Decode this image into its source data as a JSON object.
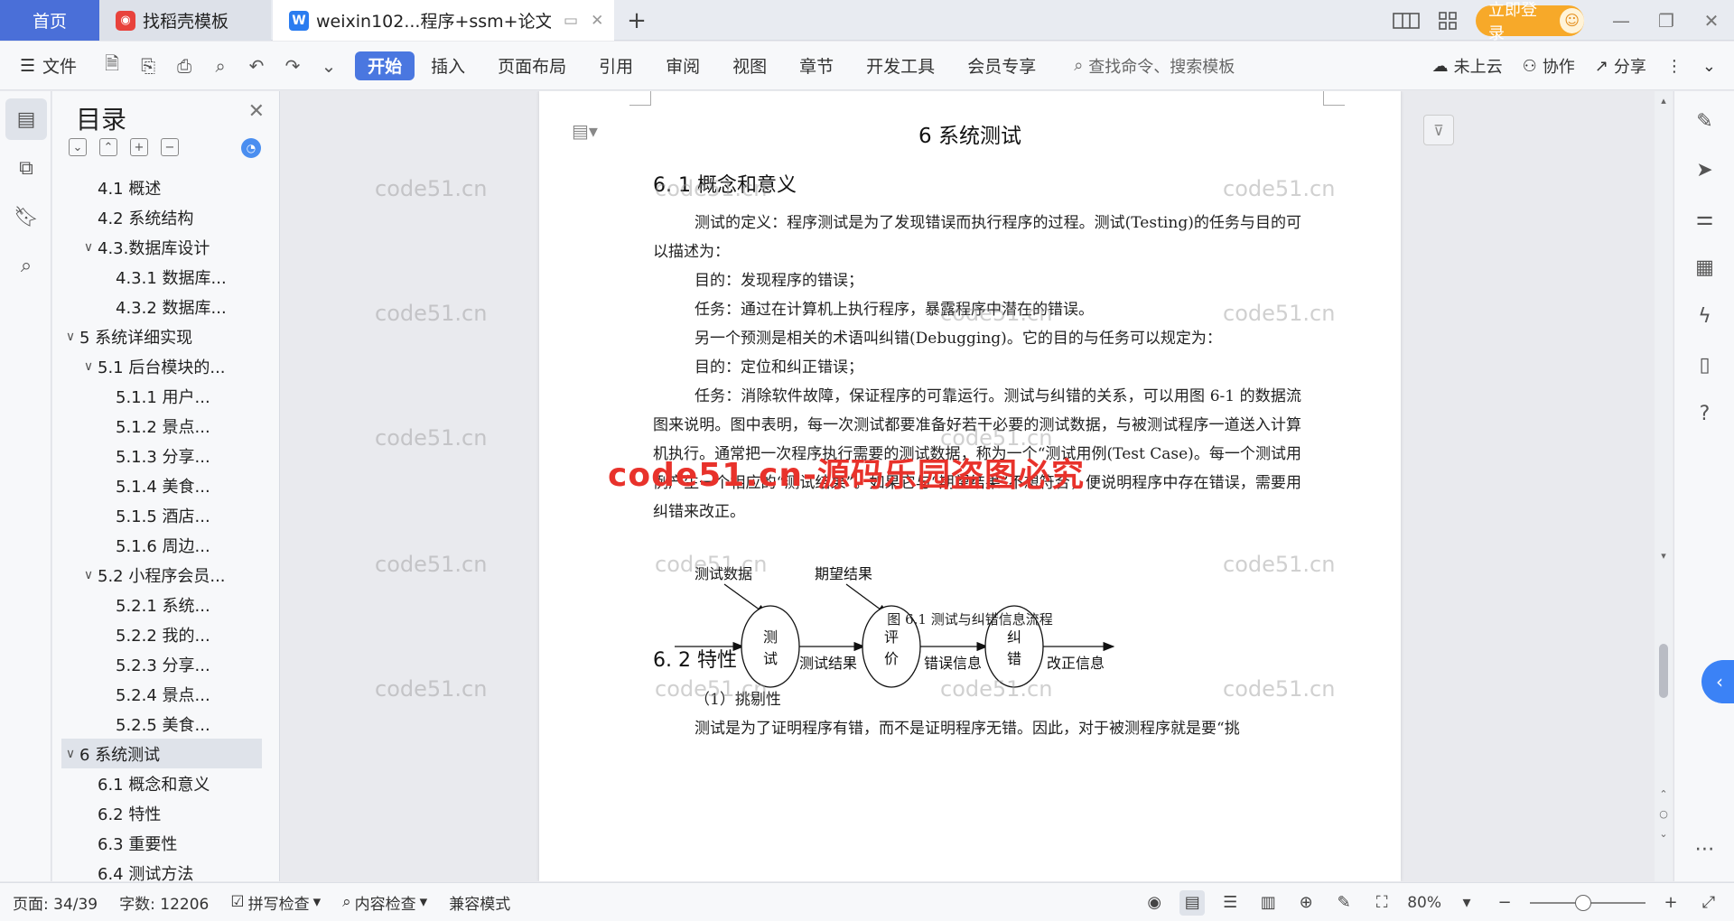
{
  "tabs": {
    "home": "首页",
    "template": "找稻壳模板",
    "document": "weixin102...程序+ssm+论文",
    "add_icon": "plus-icon"
  },
  "account": {
    "login": "立即登录"
  },
  "toolbar": {
    "file": "文件",
    "tabs": [
      "开始",
      "插入",
      "页面布局",
      "引用",
      "审阅",
      "视图",
      "章节",
      "开发工具",
      "会员专享"
    ],
    "search_placeholder": "查找命令、搜索模板",
    "cloud": "未上云",
    "collab": "协作",
    "share": "分享"
  },
  "toc": {
    "title": "目录",
    "items": [
      {
        "label": "4.1 概述",
        "level": 2,
        "arrow": ""
      },
      {
        "label": "4.2 系统结构",
        "level": 2,
        "arrow": ""
      },
      {
        "label": "4.3.数据库设计",
        "level": 2,
        "arrow": "∨"
      },
      {
        "label": "4.3.1 数据库...",
        "level": 3,
        "arrow": ""
      },
      {
        "label": "4.3.2 数据库...",
        "level": 3,
        "arrow": ""
      },
      {
        "label": "5 系统详细实现",
        "level": 1,
        "arrow": "∨"
      },
      {
        "label": "5.1 后台模块的...",
        "level": 2,
        "arrow": "∨"
      },
      {
        "label": "5.1.1 用户...",
        "level": 3,
        "arrow": ""
      },
      {
        "label": "5.1.2 景点...",
        "level": 3,
        "arrow": ""
      },
      {
        "label": "5.1.3 分享...",
        "level": 3,
        "arrow": ""
      },
      {
        "label": "5.1.4 美食...",
        "level": 3,
        "arrow": ""
      },
      {
        "label": "5.1.5 酒店...",
        "level": 3,
        "arrow": ""
      },
      {
        "label": "5.1.6 周边...",
        "level": 3,
        "arrow": ""
      },
      {
        "label": "5.2 小程序会员...",
        "level": 2,
        "arrow": "∨"
      },
      {
        "label": "5.2.1 系统...",
        "level": 3,
        "arrow": ""
      },
      {
        "label": "5.2.2 我的...",
        "level": 3,
        "arrow": ""
      },
      {
        "label": "5.2.3 分享...",
        "level": 3,
        "arrow": ""
      },
      {
        "label": "5.2.4 景点...",
        "level": 3,
        "arrow": ""
      },
      {
        "label": "5.2.5 美食...",
        "level": 3,
        "arrow": ""
      },
      {
        "label": "6 系统测试",
        "level": 1,
        "arrow": "∨",
        "active": true
      },
      {
        "label": "6.1 概念和意义",
        "level": 2,
        "arrow": ""
      },
      {
        "label": "6.2 特性",
        "level": 2,
        "arrow": ""
      },
      {
        "label": "6.3 重要性",
        "level": 2,
        "arrow": ""
      },
      {
        "label": "6.4 测试方法",
        "level": 2,
        "arrow": ""
      }
    ]
  },
  "document": {
    "chapter_title": "6 系统测试",
    "section1_title": "6. 1 概念和意义",
    "p1": "测试的定义：程序测试是为了发现错误而执行程序的过程。测试(Testing)的任务与目的可以描述为：",
    "p2": "目的：发现程序的错误；",
    "p3": "任务：通过在计算机上执行程序，暴露程序中潜在的错误。",
    "p4": "另一个预测是相关的术语叫纠错(Debugging)。它的目的与任务可以规定为：",
    "p5": "目的：定位和纠正错误；",
    "p6": "任务：消除软件故障，保证程序的可靠运行。测试与纠错的关系，可以用图 6-1 的数据流图来说明。图中表明，每一次测试都要准备好若干必要的测试数据，与被测试程序一道送入计算机执行。通常把一次程序执行需要的测试数据，称为一个“测试用例(Test Case)。每一个测试用例产生一个相应的“测试结果”。如果它与“期望结果”不想符合，便说明程序中存在错误，需要用纠错来改正。",
    "figure": {
      "input1": "测试数据",
      "input2": "期望结果",
      "node1": [
        "测",
        "试"
      ],
      "node2": [
        "评",
        "价"
      ],
      "node3": [
        "纠",
        "错"
      ],
      "edge1": "测试结果",
      "edge2": "错误信息",
      "edge3": "改正信息",
      "caption": "图 6.1 测试与纠错信息流程"
    },
    "section2_title": "6. 2 特性",
    "p7": "（1）挑剔性",
    "p8": "测试是为了证明程序有错，而不是证明程序无错。因此，对于被测程序就是要“挑"
  },
  "watermarks": {
    "gray": "code51.cn",
    "red": "code51.cn-源码乐园盗图必究"
  },
  "status": {
    "page": "页面: 34/39",
    "words": "字数: 12206",
    "spell": "拼写检查",
    "content_check": "内容检查",
    "compat": "兼容模式",
    "zoom": "80%",
    "zoom_level": 0.8
  }
}
